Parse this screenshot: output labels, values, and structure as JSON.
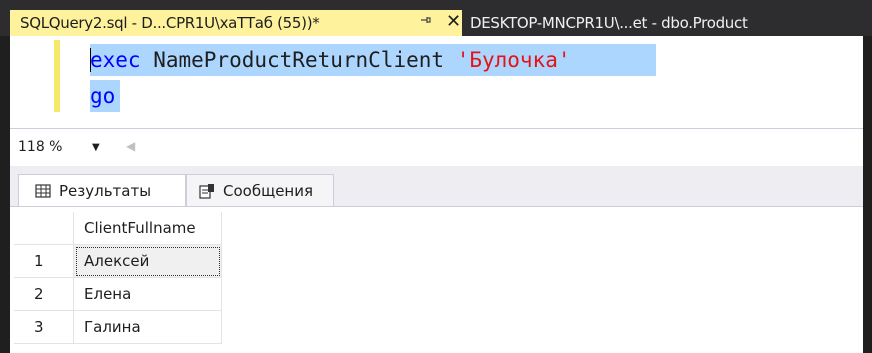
{
  "tabs": {
    "active": {
      "title": "SQLQuery2.sql - D...CPR1U\\хаТТаб (55))*",
      "pin_icon": "pin-icon",
      "close_icon": "close-icon",
      "color": "#fff29d"
    },
    "inactive": {
      "title": "DESKTOP-MNCPR1U\\...et - dbo.Product"
    }
  },
  "editor": {
    "line1": {
      "keyword": "exec",
      "procedure": "NameProductReturnClient",
      "string": "'Булочка'"
    },
    "line2": {
      "keyword": "go"
    },
    "colors": {
      "keyword": "#0000ff",
      "string": "#e51414",
      "selection": "#add6ff"
    }
  },
  "zoom": {
    "value": "118 %"
  },
  "results_panel": {
    "tabs": [
      {
        "label": "Результаты",
        "icon": "grid-icon"
      },
      {
        "label": "Сообщения",
        "icon": "messages-icon"
      }
    ],
    "grid": {
      "columns": [
        "ClientFullname"
      ],
      "rows": [
        {
          "num": "1",
          "ClientFullname": "Алексей"
        },
        {
          "num": "2",
          "ClientFullname": "Елена"
        },
        {
          "num": "3",
          "ClientFullname": "Галина"
        }
      ]
    }
  }
}
